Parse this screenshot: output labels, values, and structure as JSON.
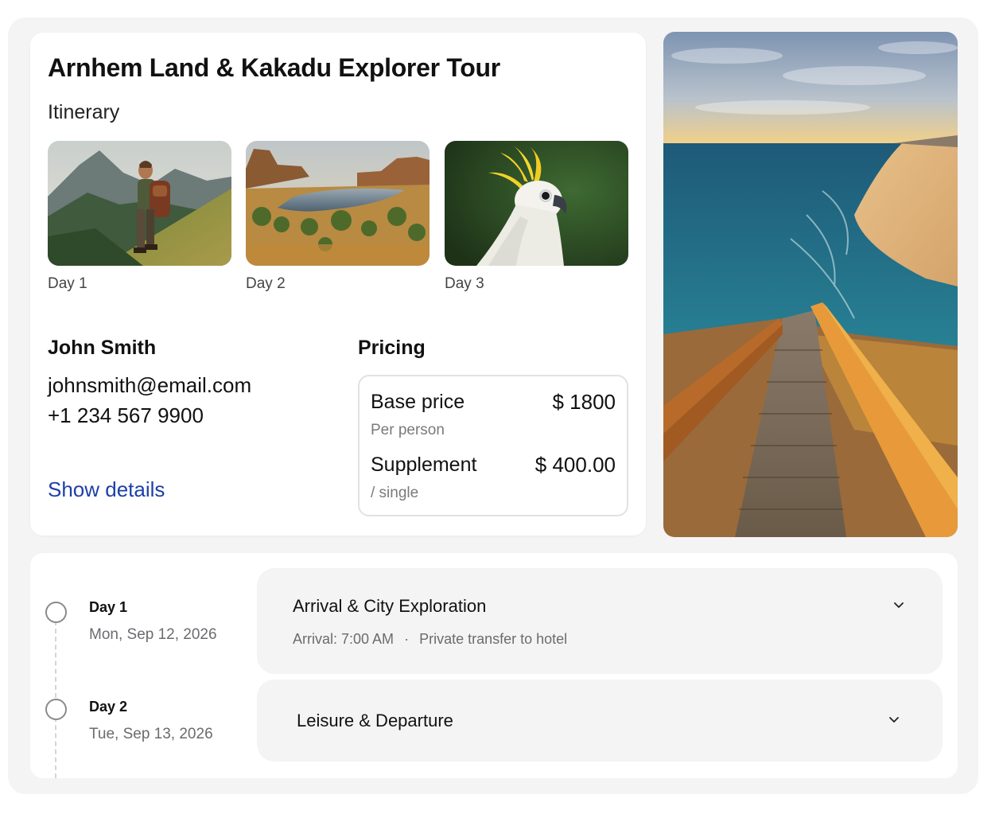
{
  "tour": {
    "title": "Arnhem Land & Kakadu Explorer Tour",
    "itinerary_label": "Itinerary",
    "thumbnails": [
      {
        "label": "Day 1",
        "icon": "hiker-mountain-image"
      },
      {
        "label": "Day 2",
        "icon": "river-gorge-image"
      },
      {
        "label": "Day 3",
        "icon": "cockatoo-image"
      }
    ]
  },
  "contact": {
    "name": "John Smith",
    "email": "johnsmith@email.com",
    "phone": "+1 234 567 9900",
    "show_details": "Show details"
  },
  "pricing": {
    "title": "Pricing",
    "base_label": "Base price",
    "base_sub": "Per person",
    "base_value": "$ 1800",
    "supp_label": "Supplement",
    "supp_sub": "/ single",
    "supp_value": "$ 400.00"
  },
  "hero": {
    "icon": "coastal-boardwalk-image"
  },
  "timeline": {
    "days": [
      {
        "label": "Day 1",
        "date": "Mon, Sep 12, 2026",
        "title": "Arrival & City Exploration",
        "arrival": "Arrival: 7:00 AM",
        "separator": "·",
        "transfer": "Private transfer to hotel"
      },
      {
        "label": "Day 2",
        "date": "Tue, Sep 13, 2026",
        "title": "Leisure & Departure"
      }
    ]
  },
  "colors": {
    "link": "#1d3fa8",
    "background": "#f4f4f5",
    "card": "#ffffff",
    "muted_text": "#6b6b70"
  }
}
